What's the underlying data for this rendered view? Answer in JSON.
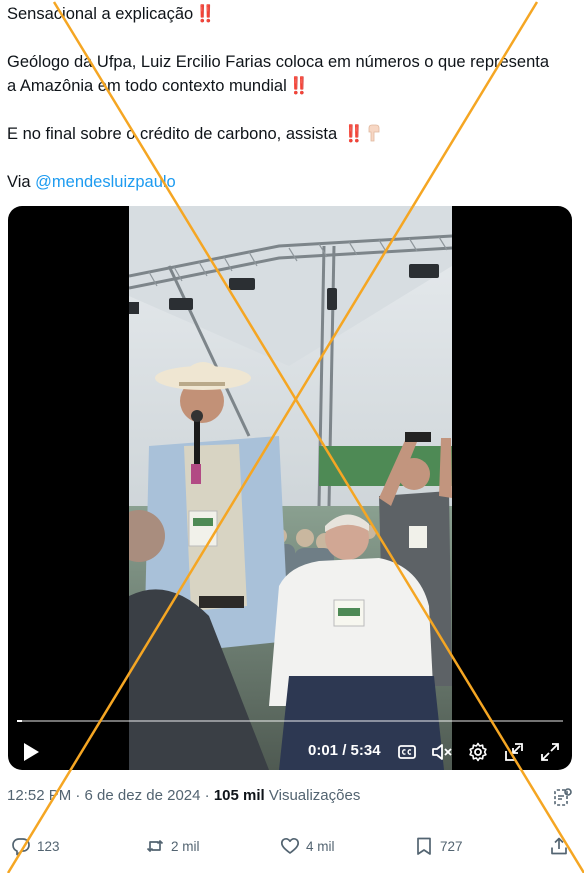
{
  "tweet": {
    "line1": "Sensacional a explicação",
    "line1_emoji": "‼️",
    "line2": "Geólogo da Ufpa, Luiz Ercilio Farias coloca em números o que representa",
    "line3": "a Amazônia em todo contexto mundial",
    "line3_emoji": "‼️",
    "line4": "E no final sobre o crédito de carbono, assista",
    "line4_emoji": "‼️",
    "via_label": "Via",
    "mention": "@mendesluizpaulo"
  },
  "video": {
    "time": "0:01 / 5:34",
    "progress_fraction": 0.003
  },
  "meta": {
    "timestamp": "12:52 PM · 6 de dez de 2024",
    "separator": "·",
    "views_count": "105 mil",
    "views_label": "Visualizações"
  },
  "actions": {
    "replies": "123",
    "reposts": "2 mil",
    "likes": "4 mil",
    "bookmarks": "727"
  },
  "colors": {
    "accent": "#1d9bf0",
    "watermark": "#f5a623",
    "muted": "#536471"
  }
}
